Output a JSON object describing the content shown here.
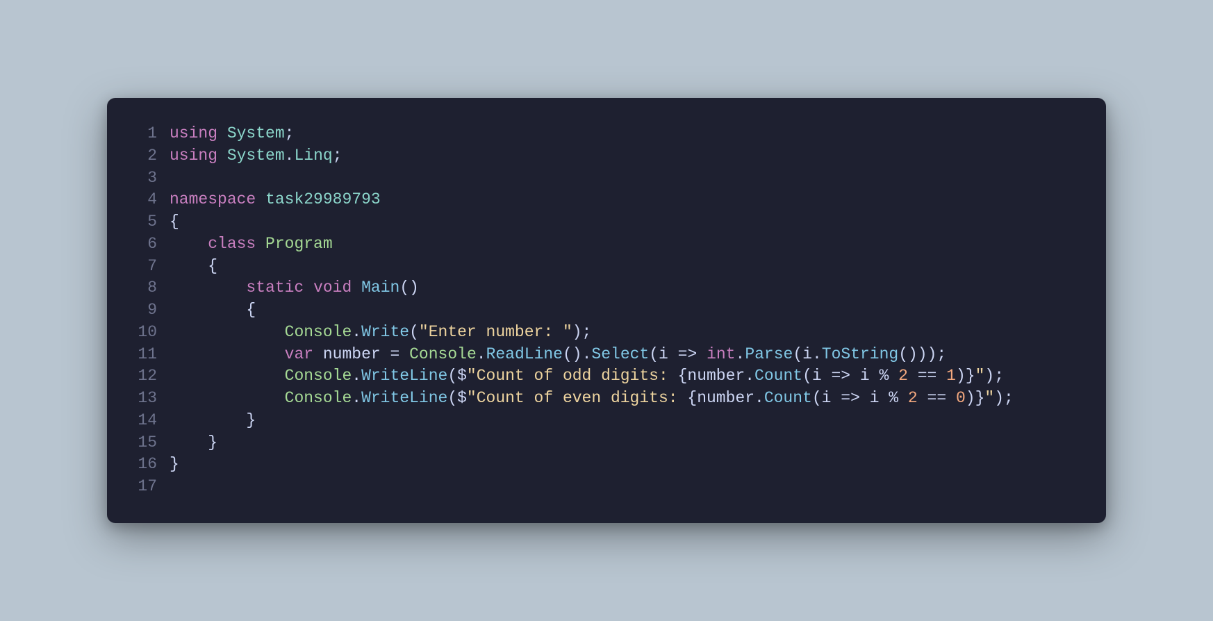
{
  "code": {
    "lines": [
      {
        "n": "1",
        "tokens": [
          {
            "cls": "tk-keyword",
            "t": "using"
          },
          {
            "cls": "tk-punct",
            "t": " "
          },
          {
            "cls": "tk-type",
            "t": "System"
          },
          {
            "cls": "tk-punct",
            "t": ";"
          }
        ]
      },
      {
        "n": "2",
        "tokens": [
          {
            "cls": "tk-keyword",
            "t": "using"
          },
          {
            "cls": "tk-punct",
            "t": " "
          },
          {
            "cls": "tk-type",
            "t": "System"
          },
          {
            "cls": "tk-punct",
            "t": "."
          },
          {
            "cls": "tk-type",
            "t": "Linq"
          },
          {
            "cls": "tk-punct",
            "t": ";"
          }
        ]
      },
      {
        "n": "3",
        "tokens": []
      },
      {
        "n": "4",
        "tokens": [
          {
            "cls": "tk-keyword",
            "t": "namespace"
          },
          {
            "cls": "tk-punct",
            "t": " "
          },
          {
            "cls": "tk-type",
            "t": "task29989793"
          }
        ]
      },
      {
        "n": "5",
        "tokens": [
          {
            "cls": "tk-punct",
            "t": "{"
          }
        ]
      },
      {
        "n": "6",
        "tokens": [
          {
            "cls": "tk-punct",
            "t": "    "
          },
          {
            "cls": "tk-keyword",
            "t": "class"
          },
          {
            "cls": "tk-punct",
            "t": " "
          },
          {
            "cls": "tk-class",
            "t": "Program"
          }
        ]
      },
      {
        "n": "7",
        "tokens": [
          {
            "cls": "tk-punct",
            "t": "    {"
          }
        ]
      },
      {
        "n": "8",
        "tokens": [
          {
            "cls": "tk-punct",
            "t": "        "
          },
          {
            "cls": "tk-keyword",
            "t": "static"
          },
          {
            "cls": "tk-punct",
            "t": " "
          },
          {
            "cls": "tk-keyword",
            "t": "void"
          },
          {
            "cls": "tk-punct",
            "t": " "
          },
          {
            "cls": "tk-method",
            "t": "Main"
          },
          {
            "cls": "tk-punct",
            "t": "()"
          }
        ]
      },
      {
        "n": "9",
        "tokens": [
          {
            "cls": "tk-punct",
            "t": "        {"
          }
        ]
      },
      {
        "n": "10",
        "tokens": [
          {
            "cls": "tk-punct",
            "t": "            "
          },
          {
            "cls": "tk-class",
            "t": "Console"
          },
          {
            "cls": "tk-punct",
            "t": "."
          },
          {
            "cls": "tk-method",
            "t": "Write"
          },
          {
            "cls": "tk-punct",
            "t": "("
          },
          {
            "cls": "tk-string",
            "t": "\"Enter number: \""
          },
          {
            "cls": "tk-punct",
            "t": ");"
          }
        ]
      },
      {
        "n": "11",
        "tokens": [
          {
            "cls": "tk-punct",
            "t": "            "
          },
          {
            "cls": "tk-keyword",
            "t": "var"
          },
          {
            "cls": "tk-punct",
            "t": " "
          },
          {
            "cls": "tk-var",
            "t": "number"
          },
          {
            "cls": "tk-punct",
            "t": " = "
          },
          {
            "cls": "tk-class",
            "t": "Console"
          },
          {
            "cls": "tk-punct",
            "t": "."
          },
          {
            "cls": "tk-method",
            "t": "ReadLine"
          },
          {
            "cls": "tk-punct",
            "t": "()."
          },
          {
            "cls": "tk-method",
            "t": "Select"
          },
          {
            "cls": "tk-punct",
            "t": "("
          },
          {
            "cls": "tk-var",
            "t": "i"
          },
          {
            "cls": "tk-punct",
            "t": " => "
          },
          {
            "cls": "tk-keyword",
            "t": "int"
          },
          {
            "cls": "tk-punct",
            "t": "."
          },
          {
            "cls": "tk-method",
            "t": "Parse"
          },
          {
            "cls": "tk-punct",
            "t": "("
          },
          {
            "cls": "tk-var",
            "t": "i"
          },
          {
            "cls": "tk-punct",
            "t": "."
          },
          {
            "cls": "tk-method",
            "t": "ToString"
          },
          {
            "cls": "tk-punct",
            "t": "()));"
          }
        ]
      },
      {
        "n": "12",
        "tokens": [
          {
            "cls": "tk-punct",
            "t": "            "
          },
          {
            "cls": "tk-class",
            "t": "Console"
          },
          {
            "cls": "tk-punct",
            "t": "."
          },
          {
            "cls": "tk-method",
            "t": "WriteLine"
          },
          {
            "cls": "tk-punct",
            "t": "($"
          },
          {
            "cls": "tk-string",
            "t": "\"Count of odd digits: "
          },
          {
            "cls": "tk-punct",
            "t": "{"
          },
          {
            "cls": "tk-var",
            "t": "number"
          },
          {
            "cls": "tk-punct",
            "t": "."
          },
          {
            "cls": "tk-method",
            "t": "Count"
          },
          {
            "cls": "tk-punct",
            "t": "("
          },
          {
            "cls": "tk-var",
            "t": "i"
          },
          {
            "cls": "tk-punct",
            "t": " => "
          },
          {
            "cls": "tk-var",
            "t": "i"
          },
          {
            "cls": "tk-punct",
            "t": " % "
          },
          {
            "cls": "tk-num",
            "t": "2"
          },
          {
            "cls": "tk-punct",
            "t": " == "
          },
          {
            "cls": "tk-num",
            "t": "1"
          },
          {
            "cls": "tk-punct",
            "t": ")}"
          },
          {
            "cls": "tk-string",
            "t": "\""
          },
          {
            "cls": "tk-punct",
            "t": ");"
          }
        ]
      },
      {
        "n": "13",
        "tokens": [
          {
            "cls": "tk-punct",
            "t": "            "
          },
          {
            "cls": "tk-class",
            "t": "Console"
          },
          {
            "cls": "tk-punct",
            "t": "."
          },
          {
            "cls": "tk-method",
            "t": "WriteLine"
          },
          {
            "cls": "tk-punct",
            "t": "($"
          },
          {
            "cls": "tk-string",
            "t": "\"Count of even digits: "
          },
          {
            "cls": "tk-punct",
            "t": "{"
          },
          {
            "cls": "tk-var",
            "t": "number"
          },
          {
            "cls": "tk-punct",
            "t": "."
          },
          {
            "cls": "tk-method",
            "t": "Count"
          },
          {
            "cls": "tk-punct",
            "t": "("
          },
          {
            "cls": "tk-var",
            "t": "i"
          },
          {
            "cls": "tk-punct",
            "t": " => "
          },
          {
            "cls": "tk-var",
            "t": "i"
          },
          {
            "cls": "tk-punct",
            "t": " % "
          },
          {
            "cls": "tk-num",
            "t": "2"
          },
          {
            "cls": "tk-punct",
            "t": " == "
          },
          {
            "cls": "tk-num",
            "t": "0"
          },
          {
            "cls": "tk-punct",
            "t": ")}"
          },
          {
            "cls": "tk-string",
            "t": "\""
          },
          {
            "cls": "tk-punct",
            "t": ");"
          }
        ]
      },
      {
        "n": "14",
        "tokens": [
          {
            "cls": "tk-punct",
            "t": "        }"
          }
        ]
      },
      {
        "n": "15",
        "tokens": [
          {
            "cls": "tk-punct",
            "t": "    }"
          }
        ]
      },
      {
        "n": "16",
        "tokens": [
          {
            "cls": "tk-punct",
            "t": "}"
          }
        ]
      },
      {
        "n": "17",
        "tokens": []
      }
    ]
  },
  "colors": {
    "background_page": "#b8c5d0",
    "background_panel": "#1e2030",
    "lineno": "#6e738d",
    "keyword": "#c97fc0",
    "type": "#8bd5ca",
    "class": "#a6da95",
    "method": "#81c8e6",
    "punct": "#cdd6f4",
    "string": "#eed49f",
    "var": "#cdd6f4",
    "num": "#f5a97f"
  }
}
